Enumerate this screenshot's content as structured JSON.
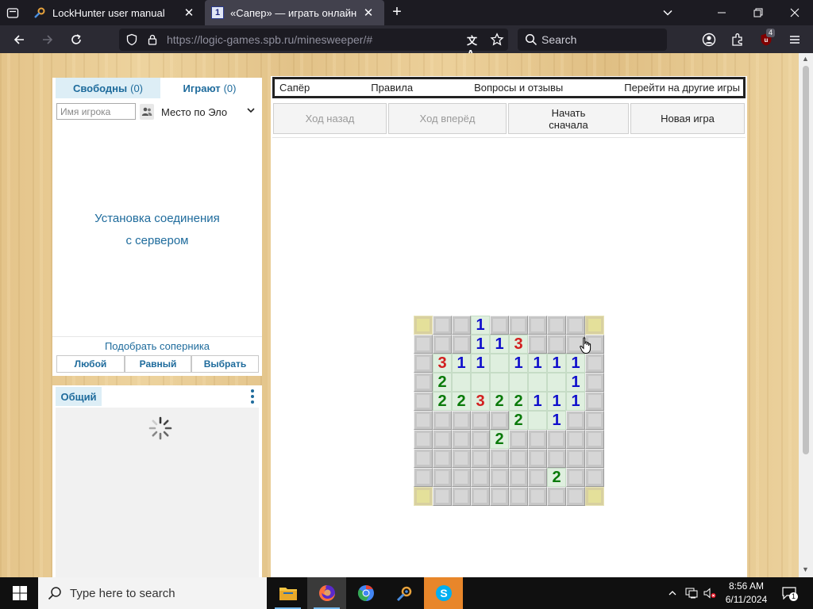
{
  "browser": {
    "tabs": [
      {
        "title": "LockHunter user manual",
        "active": false
      },
      {
        "title": "«Сапер» — играть онлайн",
        "active": true
      }
    ],
    "url": {
      "host": "https://logic-games.spb.ru",
      "path": "/minesweeper/#"
    },
    "search_placeholder": "Search",
    "extension_badge": "4"
  },
  "left_panel": {
    "tabs": [
      {
        "label": "Свободны",
        "count": "(0)"
      },
      {
        "label": "Играют",
        "count": "(0)"
      }
    ],
    "player_placeholder": "Имя игрока",
    "sort_select": "Место по Эло",
    "connection_line1": "Установка соединения",
    "connection_line2": "с сервером",
    "pick_opponent": "Подобрать соперника",
    "pick_buttons": [
      "Любой",
      "Равный",
      "Выбрать"
    ]
  },
  "chat": {
    "tab": "Общий"
  },
  "game": {
    "menu": [
      "Сапёр",
      "Правила",
      "Вопросы и отзывы",
      "Перейти на другие игры"
    ],
    "buttons": {
      "undo": "Ход назад",
      "redo": "Ход вперёд",
      "restart_line1": "Начать",
      "restart_line2": "сначала",
      "new_game": "Новая игра"
    },
    "board": {
      "rows": 10,
      "cols": 10,
      "cells": [
        [
          -1,
          -1,
          -1,
          1,
          -1,
          -1,
          -1,
          -1,
          -1,
          -1
        ],
        [
          -1,
          -1,
          -1,
          1,
          1,
          3,
          -1,
          -1,
          -1,
          -1
        ],
        [
          -1,
          3,
          1,
          1,
          0,
          1,
          1,
          1,
          1,
          -1
        ],
        [
          -1,
          2,
          0,
          0,
          0,
          0,
          0,
          0,
          1,
          -1
        ],
        [
          -1,
          2,
          2,
          3,
          2,
          2,
          1,
          1,
          1,
          -1
        ],
        [
          -1,
          -1,
          -1,
          -1,
          -1,
          2,
          0,
          1,
          -1,
          -1
        ],
        [
          -1,
          -1,
          -1,
          -1,
          2,
          -1,
          -1,
          -1,
          -1,
          -1
        ],
        [
          -1,
          -1,
          -1,
          -1,
          -1,
          -1,
          -1,
          -1,
          -1,
          -1
        ],
        [
          -1,
          -1,
          -1,
          -1,
          -1,
          -1,
          -1,
          2,
          -1,
          -1
        ],
        [
          -1,
          -1,
          -1,
          -1,
          -1,
          -1,
          -1,
          -1,
          -1,
          -1
        ]
      ],
      "highlighted_corners": [
        [
          0,
          0
        ],
        [
          0,
          9
        ],
        [
          9,
          0
        ],
        [
          9,
          9
        ]
      ],
      "number_colors": {
        "1": "#1010cc",
        "2": "#0a7a0a",
        "3": "#d21f1f"
      }
    }
  },
  "taskbar": {
    "search_placeholder": "Type here to search",
    "apps": [
      "file-explorer",
      "firefox",
      "chrome",
      "lockhunter",
      "skype"
    ],
    "time": "8:56 AM",
    "date": "6/11/2024",
    "notifications": "1"
  },
  "colors": {
    "accent": "#1e6b9c",
    "tab_active": "#42414d",
    "toolbar": "#2b2a33"
  }
}
